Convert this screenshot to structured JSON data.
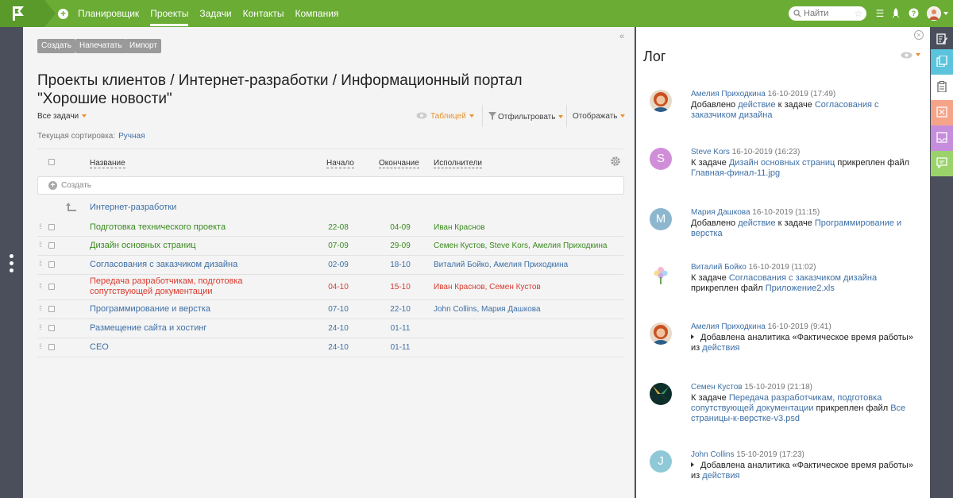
{
  "nav": {
    "items": [
      "Планировщик",
      "Проекты",
      "Задачи",
      "Контакты",
      "Компания"
    ],
    "active": "Проекты",
    "search_placeholder": "Найти"
  },
  "toolbar": {
    "create": "Создать",
    "print": "Напечатать",
    "import": "Импорт"
  },
  "page": {
    "title_line1": "Проекты клиентов / Интернет-разработки / Информационный портал",
    "title_line2": "\"Хорошие новости\"",
    "filter_all": "Все задачи",
    "view": "Таблицей",
    "filter": "Отфильтровать",
    "display": "Отображать",
    "sort_label": "Текущая сортировка:",
    "sort_value": "Ручная"
  },
  "table": {
    "columns": {
      "name": "Название",
      "start": "Начало",
      "end": "Окончание",
      "assignees": "Исполнители"
    },
    "create_label": "Создать",
    "group": "Интернет-разработки",
    "rows": [
      {
        "name": "Подготовка технического проекта",
        "start": "22-08",
        "end": "04-09",
        "assignees": "Иван Краснов",
        "status": "green"
      },
      {
        "name": "Дизайн основных страниц",
        "start": "07-09",
        "end": "29-09",
        "assignees": "Семен Кустов, Steve Kors, Амелия Приходкина",
        "status": "green"
      },
      {
        "name": "Согласования с заказчиком дизайна",
        "start": "02-09",
        "end": "18-10",
        "assignees": "Виталий Бойко, Амелия Приходкина",
        "status": "blue"
      },
      {
        "name": "Передача разработчикам, подготовка сопутствующей документации",
        "start": "04-10",
        "end": "15-10",
        "assignees": "Иван Краснов, Семен Кустов",
        "status": "red"
      },
      {
        "name": "Программирование и верстка",
        "start": "07-10",
        "end": "22-10",
        "assignees": "John Collins, Мария Дашкова",
        "status": "blue"
      },
      {
        "name": "Размещение сайта и хостинг",
        "start": "24-10",
        "end": "01-11",
        "assignees": "",
        "status": "blue"
      },
      {
        "name": "CEO",
        "start": "24-10",
        "end": "01-11",
        "assignees": "",
        "status": "blue"
      }
    ]
  },
  "colors": {
    "green": "#3a8a1f",
    "blue": "#3d6fa6",
    "red": "#d93b2f",
    "brand": "#6aac34"
  },
  "log": {
    "title": "Лог",
    "entries": [
      {
        "author": "Амелия Приходкина",
        "time": "16-10-2019 (17:49)",
        "avatar": "photo-red-hair",
        "parts": [
          "Добавлено ",
          "действие",
          " к задаче ",
          "Согласования с заказчиком дизайна",
          ""
        ]
      },
      {
        "author": "Steve Kors",
        "time": "16-10-2019 (16:23)",
        "avatar_letter": "S",
        "avatar_color": "#d18ed8",
        "parts": [
          "К задаче ",
          "Дизайн основных страниц",
          " прикреплен файл ",
          "Главная-финал-11.jpg",
          ""
        ]
      },
      {
        "author": "Мария Дашкова",
        "time": "16-10-2019 (11:15)",
        "avatar_letter": "M",
        "avatar_color": "#8db6cf",
        "parts": [
          "Добавлено ",
          "действие",
          " к задаче ",
          "Программирование и верстка",
          ""
        ]
      },
      {
        "author": "Виталий Бойко",
        "time": "16-10-2019 (11:02)",
        "avatar": "photo-flower",
        "parts": [
          "К задаче ",
          "Согласования с заказчиком дизайна",
          " прикреплен файл ",
          "Приложение2.xls",
          ""
        ]
      },
      {
        "author": "Амелия Приходкина",
        "time": "16-10-2019 (9:41)",
        "avatar": "photo-red-hair",
        "parts": [
          "Добавлена аналитика «Фактическое время работы» из ",
          "действия",
          "",
          "",
          ""
        ],
        "expand": true
      },
      {
        "author": "Семен Кустов",
        "time": "15-10-2019 (21:18)",
        "avatar": "photo-leaves",
        "parts": [
          "К задаче ",
          "Передача разработчикам, подготовка сопутствующей документации",
          " прикреплен файл ",
          "Все страницы-к-верстке-v3.psd",
          ""
        ]
      },
      {
        "author": "John Collins",
        "time": "15-10-2019 (17:23)",
        "avatar_letter": "J",
        "avatar_color": "#8fc9d8",
        "parts": [
          "Добавлена аналитика «Фактическое время работы» из ",
          "действия",
          "",
          "",
          ""
        ],
        "expand": true
      }
    ]
  }
}
